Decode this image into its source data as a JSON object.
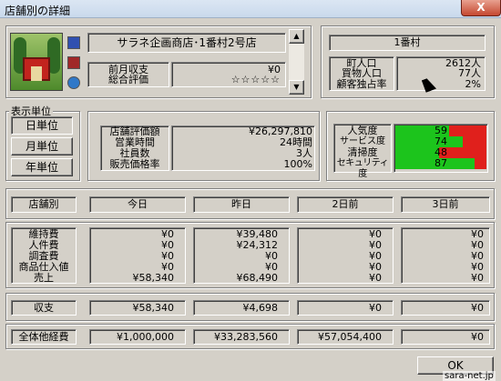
{
  "window": {
    "title": "店舗別の詳細",
    "close": "X"
  },
  "store": {
    "name": "サラネ企画商店･1番村2号店",
    "labels": [
      "前月収支",
      "総合評価"
    ],
    "prev_balance": "¥0",
    "rating": "☆☆☆☆☆"
  },
  "area": {
    "name": "1番村",
    "labels": [
      "町人口",
      "買物人口",
      "顧客独占率"
    ],
    "values": [
      "2612人",
      "77人",
      "2%"
    ]
  },
  "units": {
    "group": "表示単位",
    "buttons": [
      "日単位",
      "月単位",
      "年単位"
    ]
  },
  "detail": {
    "labels": [
      "店舗評価額",
      "営業時間",
      "社員数",
      "販売価格率"
    ],
    "values": [
      "¥26,297,810",
      "24時間",
      "3人",
      "100%"
    ]
  },
  "meters": {
    "labels": [
      "人気度",
      "サービス度",
      "清掃度",
      "セキュリティ度"
    ],
    "values": [
      59,
      74,
      48,
      87
    ],
    "colors": {
      "good": "#1cc41c",
      "bad": "#e0201c"
    }
  },
  "table": {
    "headers": [
      "店舗別",
      "今日",
      "昨日",
      "2日前",
      "3日前"
    ],
    "row_labels": [
      "維持費",
      "人件費",
      "調査費",
      "商品仕入値",
      "売上"
    ],
    "columns": [
      [
        "¥0",
        "¥0",
        "¥0",
        "¥0",
        "¥58,340"
      ],
      [
        "¥39,480",
        "¥24,312",
        "¥0",
        "¥0",
        "¥68,490"
      ],
      [
        "¥0",
        "¥0",
        "¥0",
        "¥0",
        "¥0"
      ],
      [
        "¥0",
        "¥0",
        "¥0",
        "¥0",
        "¥0"
      ]
    ],
    "balance_label": "収支",
    "balance": [
      "¥58,340",
      "¥4,698",
      "¥0",
      "¥0"
    ],
    "total_label": "全体他経費",
    "total": [
      "¥1,000,000",
      "¥33,283,560",
      "¥57,054,400",
      "¥0"
    ]
  },
  "ok": "OK",
  "watermark": "sara-net.jp"
}
